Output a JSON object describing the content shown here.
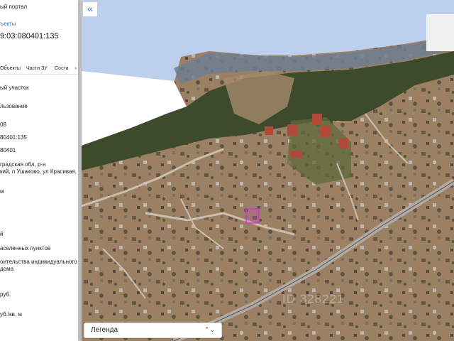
{
  "panel": {
    "portal_title": "ый портал",
    "objects_link": "ъекты",
    "cadastral_number": "9:03:080401:135",
    "tabs": [
      "Объекты",
      "Части ЗУ",
      "Соста"
    ],
    "tab_arrow": "›",
    "lines": [
      "ый участок",
      "льзование",
      "08",
      "80401:135",
      "80401",
      "градская обл, р-н",
      "кий, п Ушаково, ул Красивая,",
      "м",
      "й",
      "аселенных пунктов",
      "оительства индивидуального",
      "дома",
      "руб.",
      "уб./кв. м"
    ]
  },
  "map": {
    "collapse_icon": "«",
    "legend_label": "Легенда",
    "legend_chevron": "⌃⌄",
    "watermark": "ID 328221"
  },
  "colors": {
    "link": "#2f6fd6",
    "sea": "#bcd0ee",
    "forest": "#3d4a2c",
    "terrain": "#9b8064",
    "highway": "#b0aaa2",
    "parcel": "#d038d0"
  }
}
